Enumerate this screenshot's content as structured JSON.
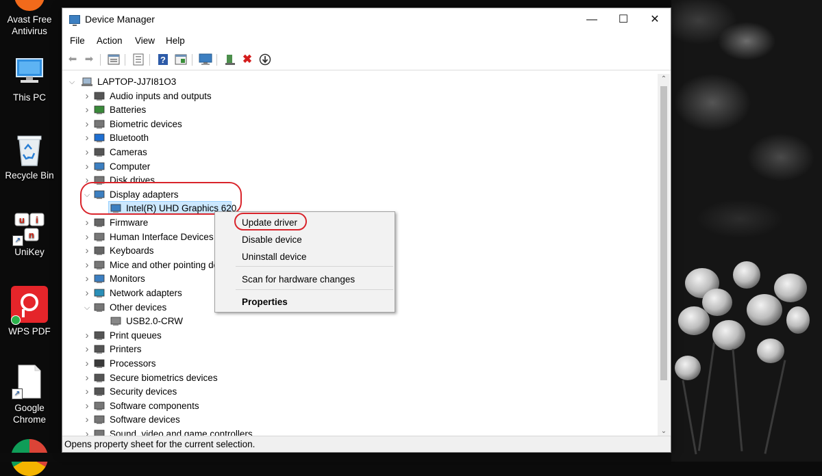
{
  "desktop": {
    "icons": [
      {
        "label": "Avast Free Antivirus",
        "icon": "avast-icon"
      },
      {
        "label": "This PC",
        "icon": "computer-icon"
      },
      {
        "label": "Recycle Bin",
        "icon": "recycle-bin-icon"
      },
      {
        "label": "UniKey",
        "icon": "unikey-icon"
      },
      {
        "label": "WPS PDF",
        "icon": "wps-pdf-icon"
      },
      {
        "label": "Google Chrome",
        "icon": "file-shortcut-icon"
      }
    ]
  },
  "window": {
    "title": "Device Manager",
    "controls": {
      "minimize": "—",
      "maximize": "☐",
      "close": "✕"
    },
    "menu": [
      "File",
      "Action",
      "View",
      "Help"
    ],
    "toolbar_icons": [
      "back-icon",
      "forward-icon",
      "properties-view-icon",
      "device-list-icon",
      "help-icon",
      "update-driver-icon",
      "monitor-icon",
      "enable-device-icon",
      "uninstall-icon",
      "download-icon"
    ]
  },
  "tree": {
    "root": "LAPTOP-JJ7I81O3",
    "items": [
      {
        "label": "Audio inputs and outputs",
        "expanded": false
      },
      {
        "label": "Batteries",
        "expanded": false
      },
      {
        "label": "Biometric devices",
        "expanded": false
      },
      {
        "label": "Bluetooth",
        "expanded": false
      },
      {
        "label": "Cameras",
        "expanded": false
      },
      {
        "label": "Computer",
        "expanded": false
      },
      {
        "label": "Disk drives",
        "expanded": false
      },
      {
        "label": "Display adapters",
        "expanded": true
      },
      {
        "label": "Intel(R) UHD Graphics 620",
        "child": true,
        "selected": true
      },
      {
        "label": "Firmware",
        "expanded": false
      },
      {
        "label": "Human Interface Devices",
        "expanded": false
      },
      {
        "label": "Keyboards",
        "expanded": false
      },
      {
        "label": "Mice and other pointing devices",
        "expanded": false
      },
      {
        "label": "Monitors",
        "expanded": false
      },
      {
        "label": "Network adapters",
        "expanded": false
      },
      {
        "label": "Other devices",
        "expanded": true
      },
      {
        "label": "USB2.0-CRW",
        "child": true
      },
      {
        "label": "Print queues",
        "expanded": false
      },
      {
        "label": "Printers",
        "expanded": false
      },
      {
        "label": "Processors",
        "expanded": false
      },
      {
        "label": "Secure biometrics devices",
        "expanded": false
      },
      {
        "label": "Security devices",
        "expanded": false
      },
      {
        "label": "Software components",
        "expanded": false
      },
      {
        "label": "Software devices",
        "expanded": false
      },
      {
        "label": "Sound, video and game controllers",
        "expanded": false
      }
    ]
  },
  "context_menu": {
    "update_driver": "Update driver",
    "disable_device": "Disable device",
    "uninstall_device": "Uninstall device",
    "scan": "Scan for hardware changes",
    "properties": "Properties"
  },
  "status": "Opens property sheet for the current selection.",
  "colors": {
    "highlight": "#d9242b",
    "selection": "#cce8ff",
    "accent": "#0078d7"
  }
}
